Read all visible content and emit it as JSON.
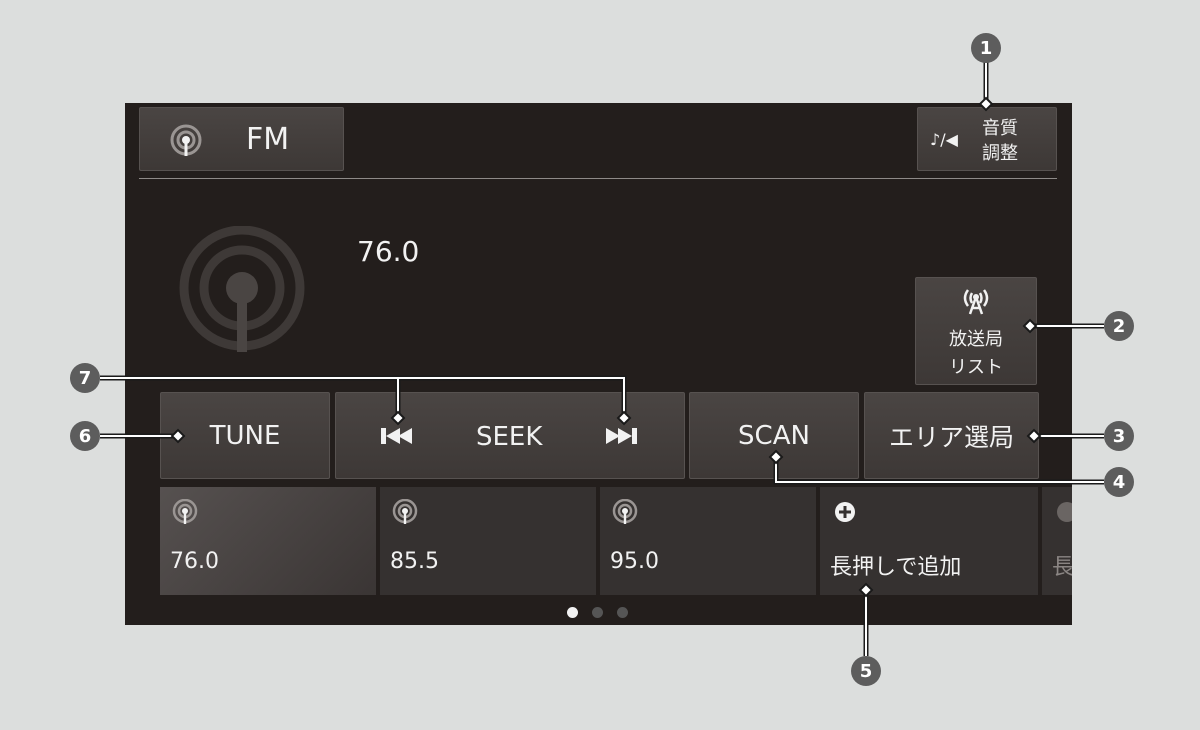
{
  "header": {
    "source_label": "FM",
    "sound_icon_text": "♪/◀",
    "sound_label_line1": "音質",
    "sound_label_line2": "調整"
  },
  "station": {
    "frequency": "76.0"
  },
  "station_list_button": {
    "line1": "放送局",
    "line2": "リスト"
  },
  "controls": {
    "tune": "TUNE",
    "seek": "SEEK",
    "scan": "SCAN",
    "area": "エリア選局"
  },
  "presets": [
    {
      "label": "76.0"
    },
    {
      "label": "85.5"
    },
    {
      "label": "95.0"
    },
    {
      "label": "長押しで追加"
    },
    {
      "label": "長"
    }
  ],
  "page_indicator": {
    "current": 1,
    "total": 3
  },
  "callouts": [
    "1",
    "2",
    "3",
    "4",
    "5",
    "6",
    "7"
  ],
  "colors": {
    "screen_bg": "#231e1c",
    "button_bg": "#413c3a",
    "callout_bg": "#5d5d5d",
    "page_bg": "#dcdedd"
  }
}
